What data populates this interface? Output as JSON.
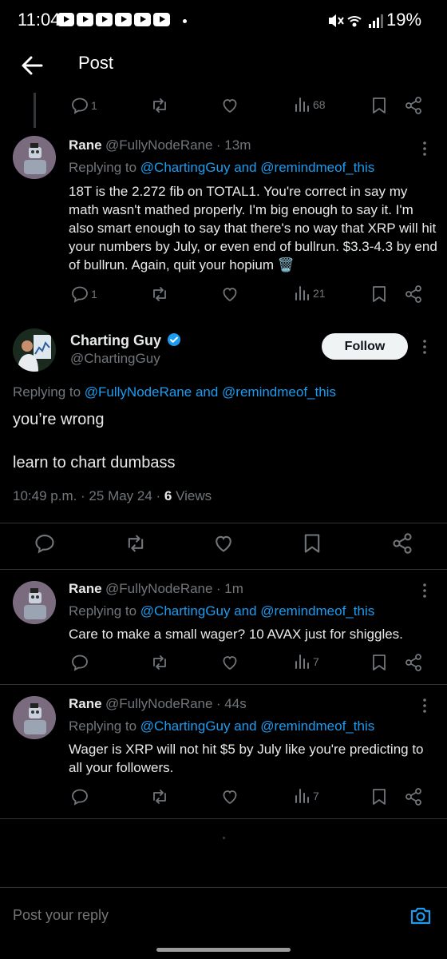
{
  "status_bar": {
    "time": "11:04",
    "battery": "19%"
  },
  "header": {
    "title": "Post"
  },
  "top_actions": {
    "replies": "1",
    "views": "68"
  },
  "tweet1": {
    "name": "Rane",
    "handle": "@FullyNodeRane",
    "time": "· 13m",
    "replying_prefix": "Replying to ",
    "mention1": "@ChartingGuy",
    "and": " and ",
    "mention2": "@remindmeof_this",
    "text": "18T is the 2.272 fib on TOTAL1. You're correct in say my math wasn't mathed properly. I'm big enough to say it. I'm also smart enough to say that there's no way that XRP will hit your numbers by July, or even end of bullrun. $3.3-4.3 by end of bullrun. Again, quit your hopium 🗑️",
    "replies": "1",
    "views": "21"
  },
  "main_tweet": {
    "name": "Charting Guy",
    "handle": "@ChartingGuy",
    "follow_label": "Follow",
    "replying_prefix": "Replying to ",
    "mention1": "@FullyNodeRane",
    "and": " and ",
    "mention2": "@remindmeof_this",
    "text_line1": "you’re wrong",
    "text_line2": "learn to chart dumbass",
    "timestamp": "10:49 p.m. · 25 May 24 · ",
    "views_count": "6",
    "views_label": " Views"
  },
  "tweet2": {
    "name": "Rane",
    "handle": "@FullyNodeRane",
    "time": "· 1m",
    "replying_prefix": "Replying to ",
    "mention1": "@ChartingGuy",
    "and": " and ",
    "mention2": "@remindmeof_this",
    "text": "Care to make a small wager? 10 AVAX just for shiggles.",
    "views": "7"
  },
  "tweet3": {
    "name": "Rane",
    "handle": "@FullyNodeRane",
    "time": "· 44s",
    "replying_prefix": "Replying to ",
    "mention1": "@ChartingGuy",
    "and": " and ",
    "mention2": "@remindmeof_this",
    "text": "Wager is XRP will not hit $5 by July like you're predicting to all your followers.",
    "views": "7"
  },
  "reply_bar": {
    "placeholder": "Post your reply"
  },
  "colors": {
    "accent": "#1d9bf0",
    "background": "#000000",
    "muted": "#71767b",
    "text": "#e7e9ea"
  }
}
